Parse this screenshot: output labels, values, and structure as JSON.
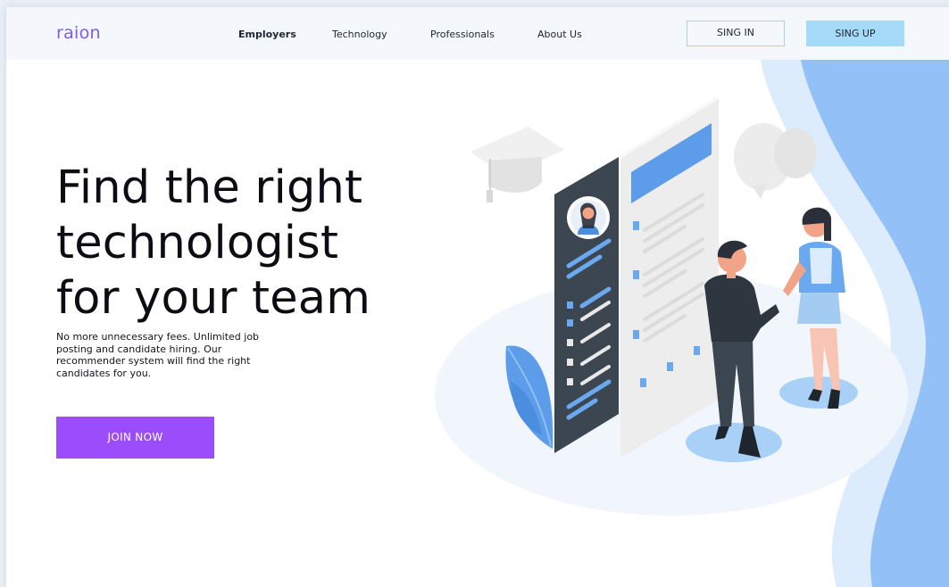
{
  "brand": {
    "logo": "raion"
  },
  "nav": {
    "items": [
      {
        "label": "Employers"
      },
      {
        "label": "Technology"
      },
      {
        "label": "Professionals"
      },
      {
        "label": "About Us"
      }
    ]
  },
  "auth": {
    "signin_label": "SING IN",
    "signup_label": "SING UP"
  },
  "hero": {
    "title_line1": "Find the right",
    "title_line2": "technologist",
    "title_line3": "for your team",
    "subtitle": "No more unnecessary fees. Unlimited job posting and candidate hiring. Our recommender system will find the right candidates for you.",
    "cta_label": "JOIN NOW"
  },
  "colors": {
    "accent": "#9b4dfb",
    "logo": "#7b5cf0",
    "signup_bg": "#a6daf9",
    "signin_border": "#a9d3f3",
    "illustration_blue": "#6aa9ef"
  }
}
